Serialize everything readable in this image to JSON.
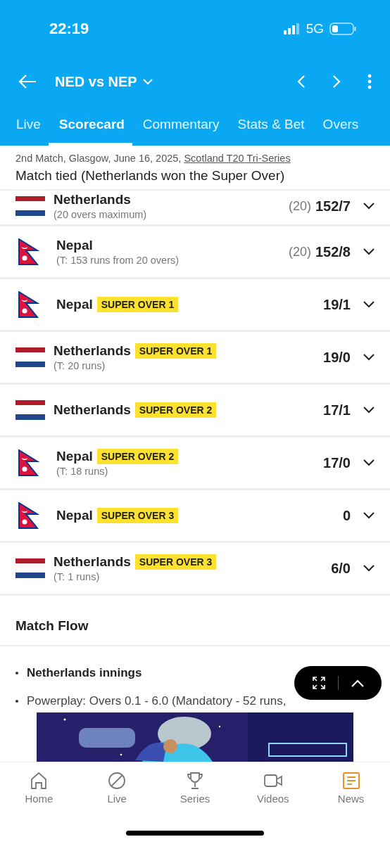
{
  "status_bar": {
    "time": "22:19",
    "network": "5G"
  },
  "header": {
    "title": "NED vs NEP"
  },
  "tabs": [
    {
      "label": "Live",
      "selected": false
    },
    {
      "label": "Scorecard",
      "selected": true
    },
    {
      "label": "Commentary",
      "selected": false
    },
    {
      "label": "Stats & Bet",
      "selected": false
    },
    {
      "label": "Overs",
      "selected": false
    }
  ],
  "match_info": {
    "details": "2nd Match, Glasgow, June 16, 2025, ",
    "series_link": "Scotland T20 Tri-Series",
    "result": "Match tied (Netherlands won the Super Over)"
  },
  "innings": [
    {
      "team": "Netherlands",
      "kind": "tricolor",
      "note": "(20 overs maximum)",
      "overs": "(20)",
      "score": "152/7"
    },
    {
      "team": "Nepal",
      "kind": "pennant",
      "note": "(T: 153 runs from 20 overs)",
      "overs": "(20)",
      "score": "152/8"
    },
    {
      "team": "Nepal",
      "kind": "pennant",
      "badge": "SUPER OVER 1",
      "score": "19/1"
    },
    {
      "team": "Netherlands",
      "kind": "tricolor",
      "badge": "SUPER OVER 1",
      "note": "(T: 20 runs)",
      "score": "19/0"
    },
    {
      "team": "Netherlands",
      "kind": "tricolor",
      "badge": "SUPER OVER 2",
      "score": "17/1"
    },
    {
      "team": "Nepal",
      "kind": "pennant",
      "badge": "SUPER OVER 2",
      "note": "(T: 18 runs)",
      "score": "17/0"
    },
    {
      "team": "Nepal",
      "kind": "pennant",
      "badge": "SUPER OVER 3",
      "score": "0"
    },
    {
      "team": "Netherlands",
      "kind": "tricolor",
      "badge": "SUPER OVER 3",
      "note": "(T: 1 runs)",
      "score": "6/0"
    }
  ],
  "match_flow": {
    "title": "Match Flow",
    "items": [
      {
        "text": "Netherlands innings",
        "kind": "heading"
      },
      {
        "text": "Powerplay: Overs 0.1 - 6.0 (Mandatory - 52 runs,",
        "kind": "plain"
      }
    ]
  },
  "bottom_nav": [
    {
      "label": "Home",
      "kind": "home",
      "selected": false
    },
    {
      "label": "Live",
      "kind": "live",
      "selected": false
    },
    {
      "label": "Series",
      "kind": "trophy",
      "selected": false
    },
    {
      "label": "Videos",
      "kind": "video",
      "selected": false
    },
    {
      "label": "News",
      "kind": "news",
      "selected": true
    }
  ]
}
